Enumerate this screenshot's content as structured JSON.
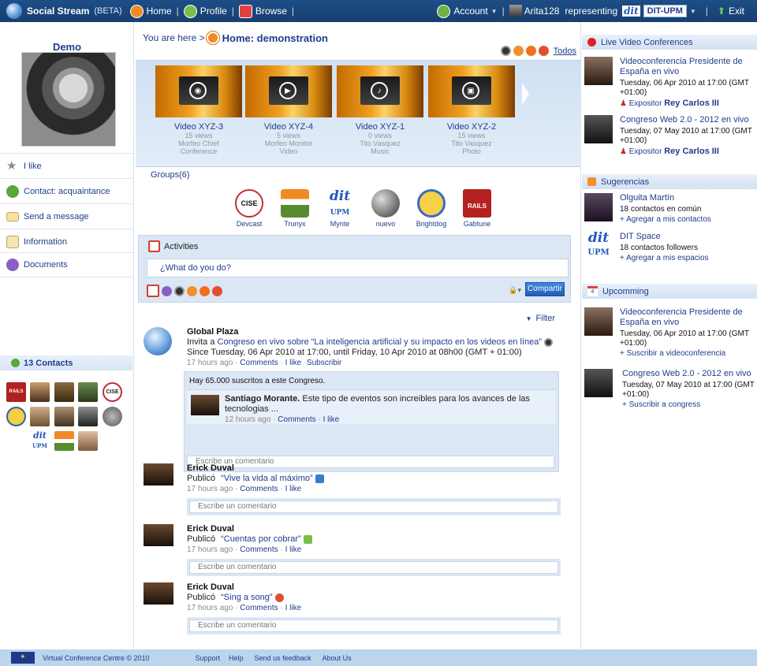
{
  "topbar": {
    "brand": "Social Stream",
    "beta": "(BETA)",
    "home": "Home",
    "profile": "Profile",
    "browse": "Browse",
    "account": "Account",
    "user": "Arita128",
    "representing": "representing",
    "dit_logo": "dit",
    "org": "DIT-UPM",
    "exit": "Exit",
    "separator": "|"
  },
  "left": {
    "profile_name": "Demo",
    "menu": [
      {
        "label": "I like",
        "icon": "star-icon"
      },
      {
        "label": "Contact: acquaintance",
        "icon": "contact-icon"
      },
      {
        "label": "Send a message",
        "icon": "envelope-icon"
      },
      {
        "label": "Information",
        "icon": "pencil-icon"
      },
      {
        "label": "Documents",
        "icon": "documents-icon"
      }
    ],
    "contacts_header": "13 Contacts",
    "contact_labels": {
      "cise": "CISE",
      "dit": "dit",
      "upm": "UPM",
      "rails": "RAILS"
    }
  },
  "center": {
    "breadcrumb_prefix": "You are here >",
    "breadcrumb_title": "Home: demonstration",
    "todos": "Todos",
    "videos": [
      {
        "title": "Video XYZ-3",
        "views": "15 views",
        "author": "Morfeo Chief",
        "category": "Conference"
      },
      {
        "title": "Video XYZ-4",
        "views": "5 views",
        "author": "Morfeo Monitor",
        "category": "Video"
      },
      {
        "title": "Video XYZ-1",
        "views": "0 views",
        "author": "Tito Vasquez",
        "category": "Music"
      },
      {
        "title": "Video XYZ-2",
        "views": "15 views",
        "author": "Tito Vasquez",
        "category": "Photo"
      }
    ],
    "groups_label": "Groups(6)",
    "groups": [
      "Devcast",
      "Trunyx",
      "Mynte",
      "nuevo",
      "Brightdog",
      "Gabtune"
    ],
    "group_logo_text": {
      "devcast": "CISE",
      "mynte_top": "dit",
      "mynte_bottom": "UPM",
      "gabtune": "RAILS"
    },
    "activities_title": "Activities",
    "what_placeholder": "¿What do you do?",
    "share_button": "Compartir",
    "filter": "Filter",
    "feed": [
      {
        "who": "Global Plaza",
        "line1_prefix": "Invita a",
        "line1_link": "Congreso en vivo sobre “La inteligencia artificial y su impacto en los videos en línea”",
        "line2": "Since Tuesday, 06 Apr 2010 at 17:00, until Friday, 10 Apr 2010 at 08h00 (GMT + 01:00)",
        "time": "17 hours ago",
        "actions": [
          "Comments",
          "I like",
          "Subscribir"
        ],
        "note": "Hay 65.000 suscritos a este Congreso.",
        "comment_author": "Santiago Morante.",
        "comment_text": "Este tipo de eventos son increibles para los avances de las tecnologias ...",
        "comment_time": "12 hours ago",
        "comment_actions": [
          "Comments",
          "I like"
        ],
        "comment_placeholder": "Escribe un comentario"
      },
      {
        "who": "Erick Duval",
        "verb": "Publicó",
        "link": "“Vive la vida al máximo”",
        "time": "17 hours ago",
        "actions": [
          "Comments",
          "I like"
        ],
        "comment_placeholder": "Escribe un comentario"
      },
      {
        "who": "Erick Duval",
        "verb": "Publicó",
        "link": "“Cuentas por cobrar”",
        "time": "17 hours ago",
        "actions": [
          "Comments",
          "I like"
        ],
        "comment_placeholder": "Escribe un comentario"
      },
      {
        "who": "Erick Duval",
        "verb": "Publicó",
        "link": "“Sing a song”",
        "time": "17 hours ago",
        "actions": [
          "Comments",
          "I like"
        ],
        "comment_placeholder": "Escribe un comentario"
      }
    ]
  },
  "right": {
    "live_header": "Live Video Conferences",
    "live": [
      {
        "title": "Videoconferencia Presidente de España en vivo",
        "date": "Tuesday, 06 Apr 2010 at 17:00 (GMT +01:00)",
        "expositor_label": "Expositor",
        "expositor": "Rey Carlos III"
      },
      {
        "title": "Congreso Web 2.0 - 2012 en vivo",
        "date": "Tuesday, 07 May 2010 at 17:00 (GMT +01:00)",
        "expositor_label": "Expositor",
        "expositor": "Rey Carlos III"
      }
    ],
    "suggest_header": "Sugerencias",
    "suggestions": [
      {
        "name": "Olguita Martín",
        "info": "18 contactos en común",
        "action": "+ Agregar a mis contactos"
      },
      {
        "name": "DIT Space",
        "info": "18 contactos followers",
        "action": "+ Agregar a mis espacios",
        "logo_top": "dit",
        "logo_bottom": "UPM"
      }
    ],
    "upcoming_header": "Upcomming",
    "calendar_day": "4",
    "upcoming": [
      {
        "title": "Videoconferencia Presidente de España en vivo",
        "date": "Tuesday, 06 Apr 2010 at 17:00 (GMT +01:00)",
        "action": "+ Suscribir a videoconferencia"
      },
      {
        "title": "Congreso Web 2.0 - 2012 en vivo",
        "date": "Tuesday, 07 May 2010 at 17:00 (GMT +01:00)",
        "action": "+ Suscribir a congress"
      }
    ]
  },
  "footer": {
    "copyright": "Virtual Conference Centre © 2010",
    "links": [
      "Support",
      "Help",
      "Send us feedback",
      "About Us"
    ]
  },
  "colors": {
    "topbar": "#1d4e86",
    "link": "#1f3c8c",
    "panel": "#dbe7f4",
    "footer": "#bcd4ec"
  }
}
